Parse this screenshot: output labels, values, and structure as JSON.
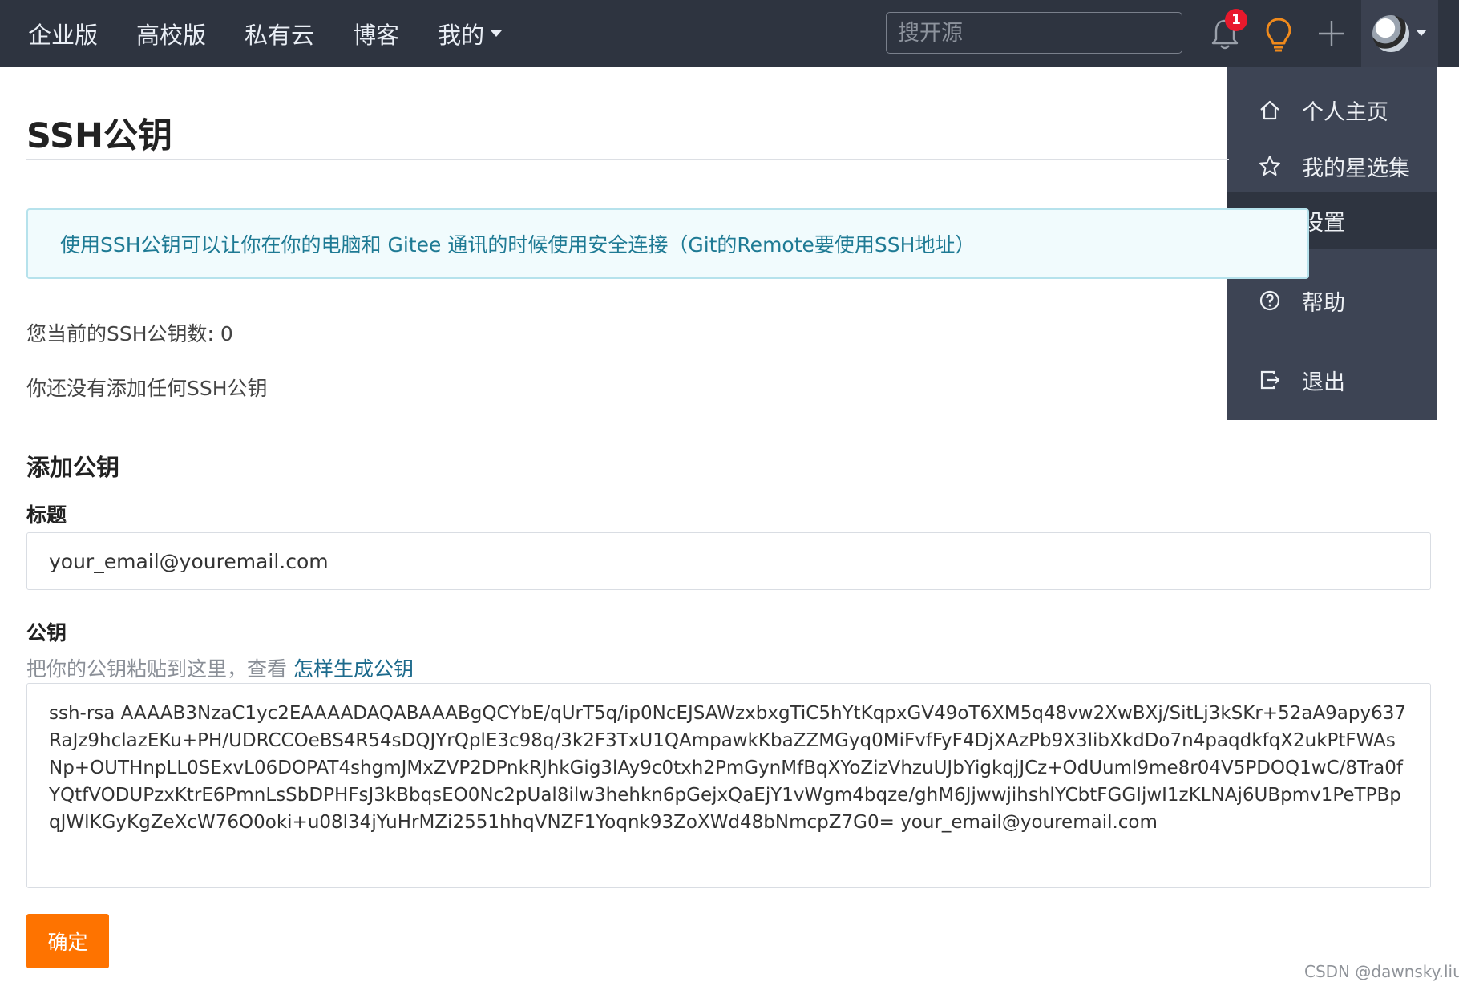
{
  "nav": {
    "links": [
      "企业版",
      "高校版",
      "私有云",
      "博客"
    ],
    "mine_label": "我的",
    "search_placeholder": "搜开源",
    "notification_count": "1"
  },
  "dropdown": {
    "items": [
      {
        "label": "个人主页",
        "icon": "home-icon"
      },
      {
        "label": "我的星选集",
        "icon": "star-icon"
      },
      {
        "label": "设置",
        "icon": "edit-icon"
      },
      {
        "label": "帮助",
        "icon": "help-circle-icon"
      },
      {
        "label": "退出",
        "icon": "logout-icon"
      }
    ],
    "active_index": 2
  },
  "page": {
    "title": "SSH公钥",
    "info": "使用SSH公钥可以让你在你的电脑和 Gitee 通讯的时候使用安全连接（Git的Remote要使用SSH地址）",
    "key_count": "您当前的SSH公钥数: 0",
    "no_keys": "你还没有添加任何SSH公钥"
  },
  "form": {
    "section_title": "添加公钥",
    "title_label": "标题",
    "title_value": "your_email@youremail.com",
    "key_label": "公钥",
    "hint_text": "把你的公钥粘贴到这里，查看 ",
    "hint_link": "怎样生成公钥",
    "key_value": "ssh-rsa AAAAB3NzaC1yc2EAAAADAQABAAABgQCYbE/qUrT5q/ip0NcEJSAWzxbxgTiC5hYtKqpxGV49oT6XM5q48vw2XwBXj/SitLj3kSKr+52aA9apy637RaJz9hclazEKu+PH/UDRCCOeBS4R54sDQJYrQplE3c98q/3k2F3TxU1QAmpawkKbaZZMGyq0MiFvfFyF4DjXAzPb9X3libXkdDo7n4paqdkfqX2ukPtFWAsNp+OUTHnpLL0SExvL06DOPAT4shgmJMxZVP2DPnkRJhkGig3lAy9c0txh2PmGynMfBqXYoZizVhzuUJbYigkqjJCz+OdUuml9me8r04V5PDOQ1wC/8Tra0fYQtfVODUPzxKtrE6PmnLsSbDPHFsJ3kBbqsEO0Nc2pUal8ilw3hehkn6pGejxQaEjY1vWgm4bqze/ghM6JjwwjihshlYCbtFGGIjwI1zKLNAj6UBpmv1PeTPBpqJWlKGyKgZeXcW76O0oki+u08l34jYuHrMZi2551hhqVNZF1Yoqnk93ZoXWd48bNmcpZ7G0= your_email@youremail.com",
    "submit_label": "确定"
  },
  "watermark": "CSDN @dawnsky.liu",
  "colors": {
    "nav_bg": "#2e3440",
    "dropdown_bg": "#3d4454",
    "accent_orange": "#fe7300",
    "info_text": "#1e7a94",
    "link": "#1c6a8c"
  }
}
